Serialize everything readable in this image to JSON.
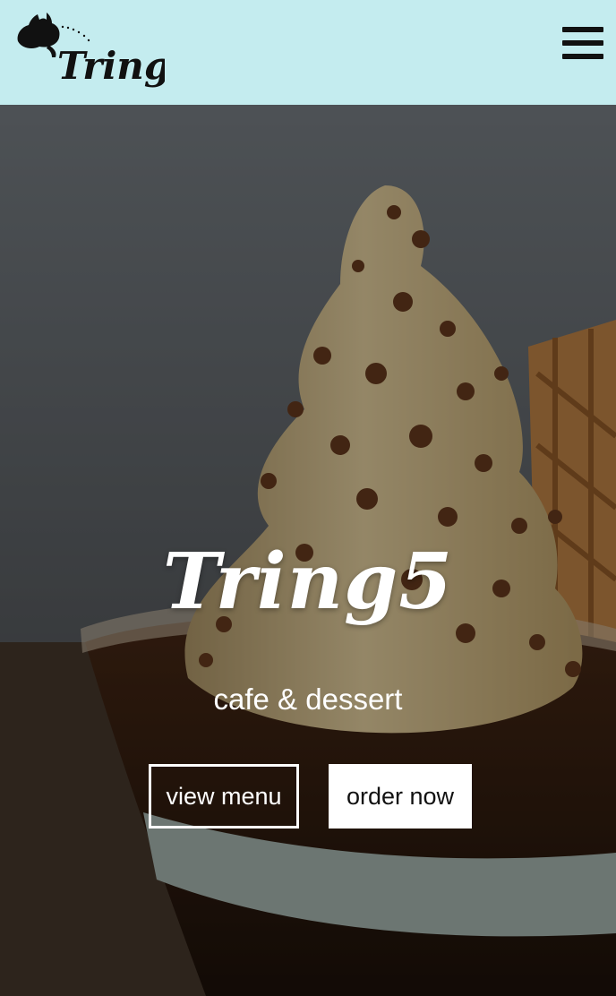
{
  "header": {
    "logo_text": "Tring5",
    "menu_icon": "hamburger-menu-icon",
    "background_color": "#c4ecef"
  },
  "hero": {
    "title": "Tring5",
    "subtitle": "cafe & dessert",
    "buttons": {
      "view_menu": "view menu",
      "order_now": "order now"
    }
  },
  "colors": {
    "header_bg": "#c4ecef",
    "text_light": "#ffffff",
    "text_dark": "#111111"
  }
}
